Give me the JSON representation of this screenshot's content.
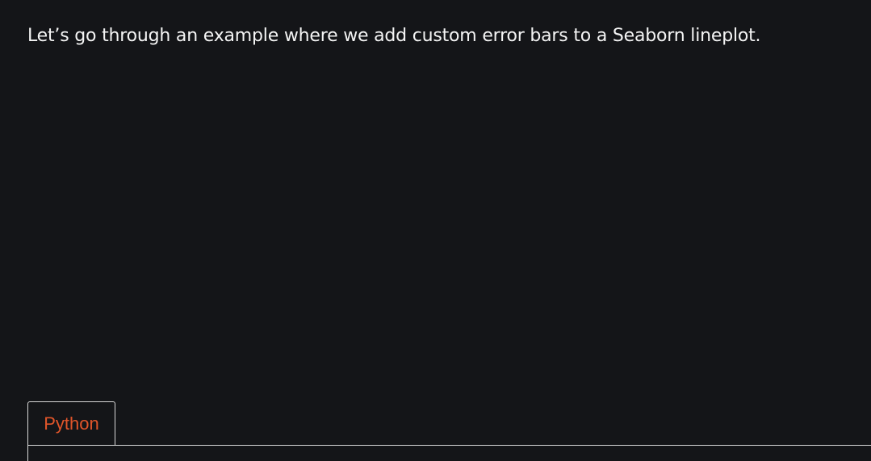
{
  "article": {
    "intro_text": "Let’s go through an example where we add custom error bars to a Seaborn lineplot."
  },
  "code_tabs": {
    "active_tab": "Python",
    "tabs": [
      {
        "label": "Python"
      }
    ]
  },
  "colors": {
    "background": "#141518",
    "text": "#f4f4f4",
    "tab_accent": "#e0552a",
    "tab_border": "#d8d8d8"
  }
}
